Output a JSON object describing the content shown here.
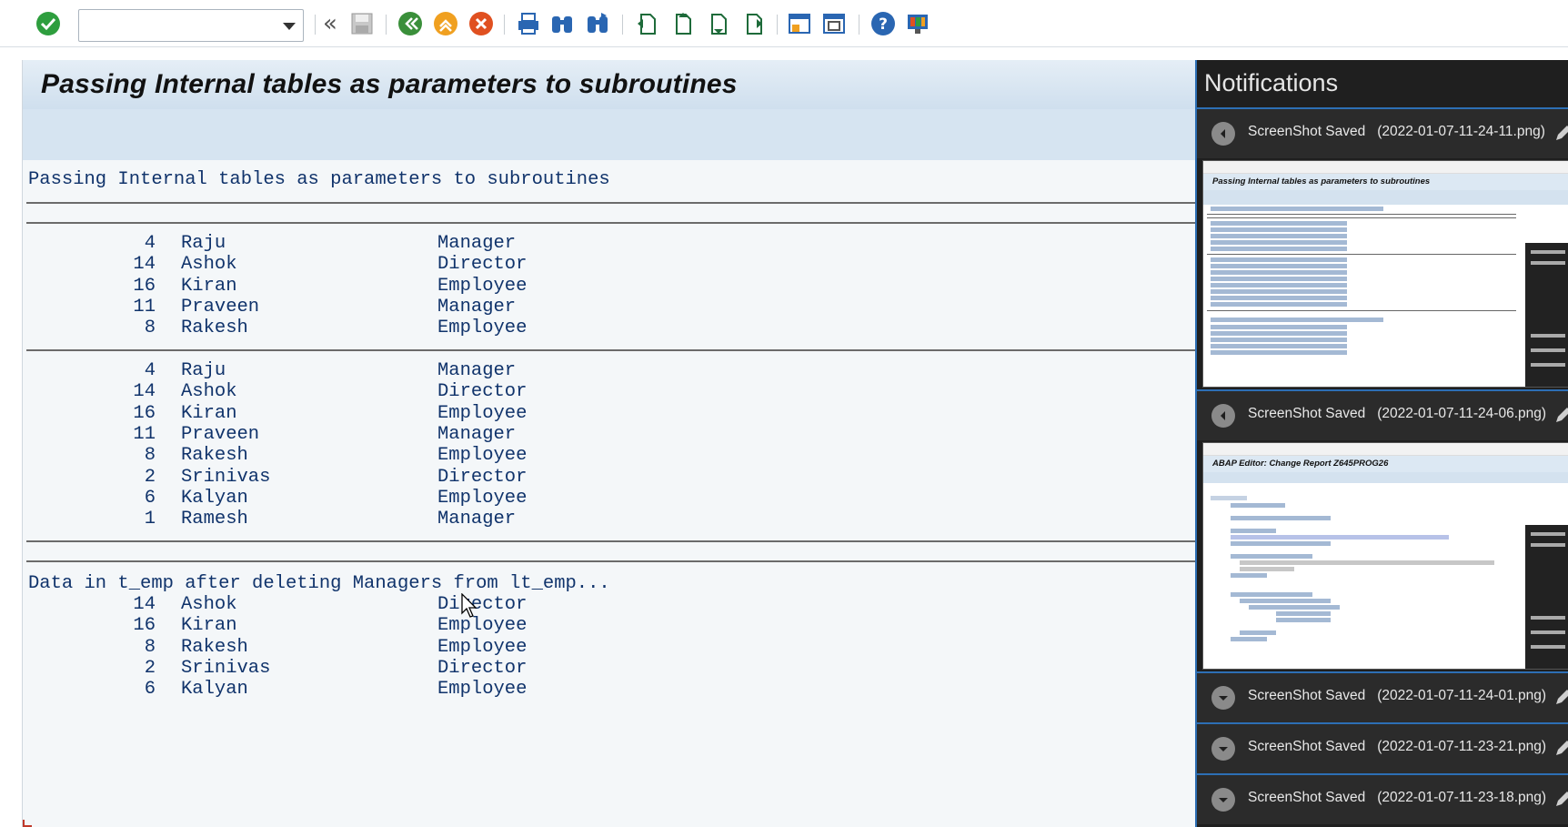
{
  "toolbar": {
    "command_value": "",
    "icons": [
      "enter-check-icon",
      "back-double-icon",
      "save-icon",
      "back-icon",
      "exit-icon",
      "cancel-icon",
      "print-icon",
      "find-icon",
      "find-next-icon",
      "first-page-icon",
      "previous-page-icon",
      "next-page-icon",
      "last-page-icon",
      "create-session-icon",
      "shortcut-icon",
      "help-icon",
      "customize-layout-icon"
    ],
    "colors": {
      "check": "#2e9e3e",
      "back": "#3a8f3a",
      "exit": "#f0a020",
      "cancel": "#e05020",
      "blue": "#2a66b2"
    }
  },
  "report": {
    "title": "Passing Internal tables as parameters to subroutines",
    "heading": "Passing Internal tables as parameters to subroutines",
    "block1": [
      {
        "id": "4",
        "name": "Raju",
        "role": "Manager"
      },
      {
        "id": "14",
        "name": "Ashok",
        "role": "Director"
      },
      {
        "id": "16",
        "name": "Kiran",
        "role": "Employee"
      },
      {
        "id": "11",
        "name": "Praveen",
        "role": "Manager"
      },
      {
        "id": "8",
        "name": "Rakesh",
        "role": "Employee"
      }
    ],
    "block2": [
      {
        "id": "4",
        "name": "Raju",
        "role": "Manager"
      },
      {
        "id": "14",
        "name": "Ashok",
        "role": "Director"
      },
      {
        "id": "16",
        "name": "Kiran",
        "role": "Employee"
      },
      {
        "id": "11",
        "name": "Praveen",
        "role": "Manager"
      },
      {
        "id": "8",
        "name": "Rakesh",
        "role": "Employee"
      },
      {
        "id": "2",
        "name": "Srinivas",
        "role": "Director"
      },
      {
        "id": "6",
        "name": "Kalyan",
        "role": "Employee"
      },
      {
        "id": "1",
        "name": "Ramesh",
        "role": "Manager"
      }
    ],
    "block3_heading": "Data in t_emp after deleting Managers from lt_emp...",
    "block3": [
      {
        "id": "14",
        "name": "Ashok",
        "role": "Director"
      },
      {
        "id": "16",
        "name": "Kiran",
        "role": "Employee"
      },
      {
        "id": "8",
        "name": "Rakesh",
        "role": "Employee"
      },
      {
        "id": "2",
        "name": "Srinivas",
        "role": "Director"
      },
      {
        "id": "6",
        "name": "Kalyan",
        "role": "Employee"
      }
    ]
  },
  "notifications": {
    "title": "Notifications",
    "items": [
      {
        "label": "ScreenShot Saved",
        "file": "(2022-01-07-11-24-11.png)",
        "expanded": true
      },
      {
        "label": "ScreenShot Saved",
        "file": "(2022-01-07-11-24-06.png)",
        "expanded": true
      },
      {
        "label": "ScreenShot Saved",
        "file": "(2022-01-07-11-24-01.png)",
        "expanded": false
      },
      {
        "label": "ScreenShot Saved",
        "file": "(2022-01-07-11-23-21.png)",
        "expanded": false
      },
      {
        "label": "ScreenShot Saved",
        "file": "(2022-01-07-11-23-18.png)",
        "expanded": false
      }
    ]
  }
}
